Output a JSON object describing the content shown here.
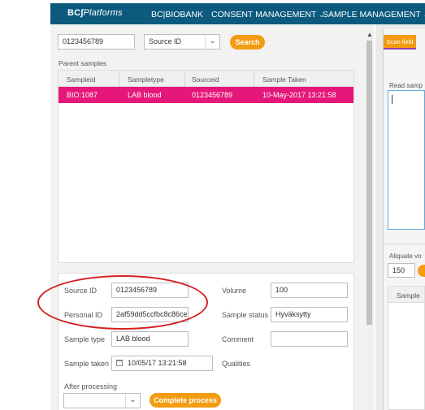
{
  "nav": {
    "logo_bold": "BC",
    "logo_thin": "Platforms",
    "items": [
      {
        "label": "BC|BIOBANK",
        "has_dropdown": false
      },
      {
        "label": "CONSENT MANAGEMENT",
        "has_dropdown": true
      },
      {
        "label": "SAMPLE MANAGEMENT",
        "has_dropdown": true
      }
    ]
  },
  "search": {
    "value": "0123456789",
    "type_selected": "Source ID",
    "button_label": "Search"
  },
  "parent_samples": {
    "heading": "Parent samples",
    "columns": [
      "Sampleid",
      "Sampletype",
      "Sourceid",
      "Sample Taken"
    ],
    "rows": [
      [
        "BIO:1087",
        "LAB blood",
        "0123456789",
        "10-May-2017 13:21:58"
      ]
    ]
  },
  "details": {
    "source_id_label": "Source ID",
    "source_id_value": "0123456789",
    "personal_id_label": "Personal ID",
    "personal_id_value": "2af59dd5ccfbc8c86ce",
    "sample_type_label": "Sample type",
    "sample_type_value": "LAB blood",
    "sample_taken_label": "Sample taken",
    "sample_taken_value": "10/05/17 13:21:58",
    "volume_label": "Volume",
    "volume_value": "100",
    "sample_status_label": "Sample status",
    "sample_status_value": "Hyväksytty",
    "comment_label": "Comment",
    "comment_value": "",
    "qualities_label": "Qualities",
    "after_processing_label": "After processing",
    "after_processing_value": "",
    "complete_button": "Complete process"
  },
  "right_panel": {
    "scan_field_btn": "Scan field",
    "read_sample_label": "Read samp",
    "aliquote_label": "Aliquate vo",
    "aliquote_value": "150",
    "sample_col": "Sample"
  },
  "colors": {
    "nav_bg": "#0c5a7d",
    "accent_orange": "#f39c12",
    "row_highlight": "#e5177a",
    "annotation_red": "#d62020"
  }
}
